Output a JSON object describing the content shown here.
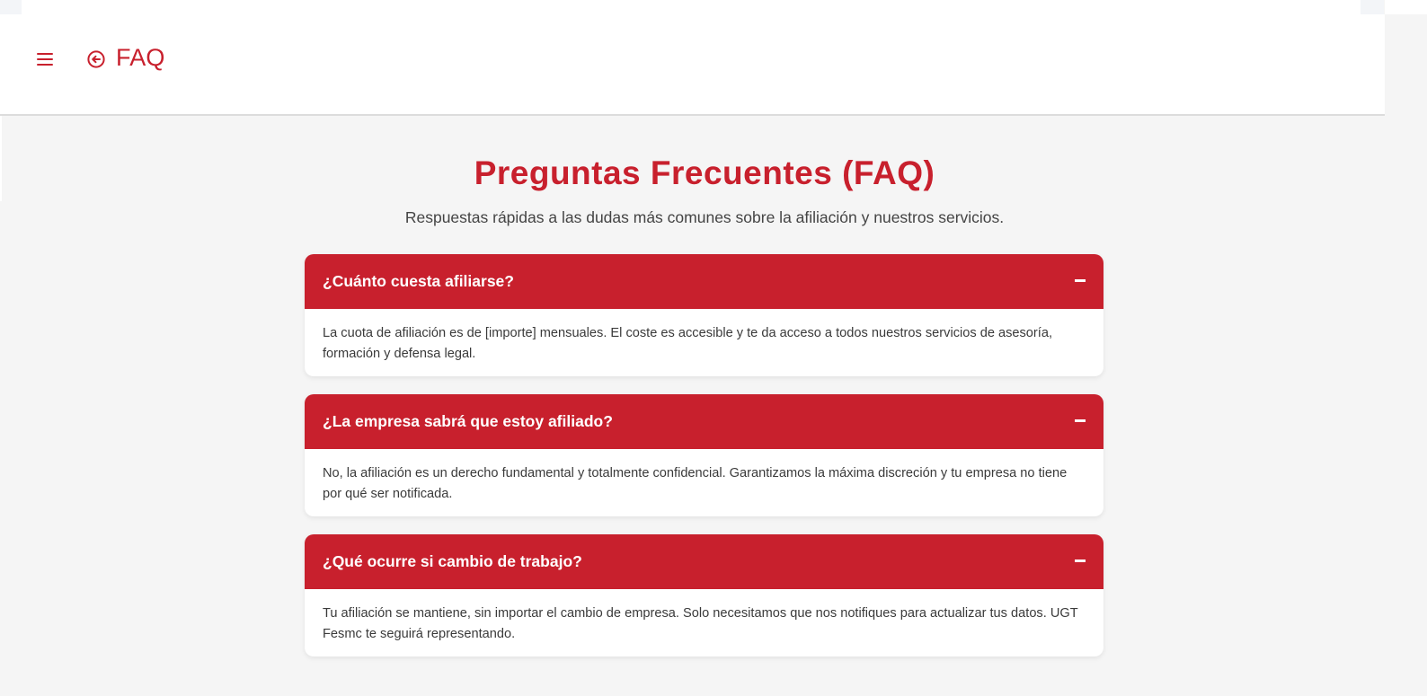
{
  "header": {
    "title": "FAQ",
    "menu_icon": "hamburger-menu-icon",
    "back_icon": "circle-arrow-left-icon"
  },
  "main": {
    "title": "Preguntas Frecuentes (FAQ)",
    "subtitle": "Respuestas rápidas a las dudas más comunes sobre la afiliación y nuestros servicios."
  },
  "faq": [
    {
      "question": "¿Cuánto cuesta afiliarse?",
      "answer": "La cuota de afiliación es de [importe] mensuales. El coste es accesible y te da acceso a todos nuestros servicios de asesoría, formación y defensa legal.",
      "expanded": true
    },
    {
      "question": "¿La empresa sabrá que estoy afiliado?",
      "answer": "No, la afiliación es un derecho fundamental y totalmente confidencial. Garantizamos la máxima discreción y tu empresa no tiene por qué ser notificada.",
      "expanded": true
    },
    {
      "question": "¿Qué ocurre si cambio de trabajo?",
      "answer": "Tu afiliación se mantiene, sin importar el cambio de empresa. Solo necesitamos que nos notifiques para actualizar tus datos. UGT Fesmc te seguirá representando.",
      "expanded": true
    }
  ],
  "colors": {
    "accent": "#c8202d",
    "background": "#f5f5f5",
    "card": "#ffffff",
    "text": "#3a3a3a"
  }
}
